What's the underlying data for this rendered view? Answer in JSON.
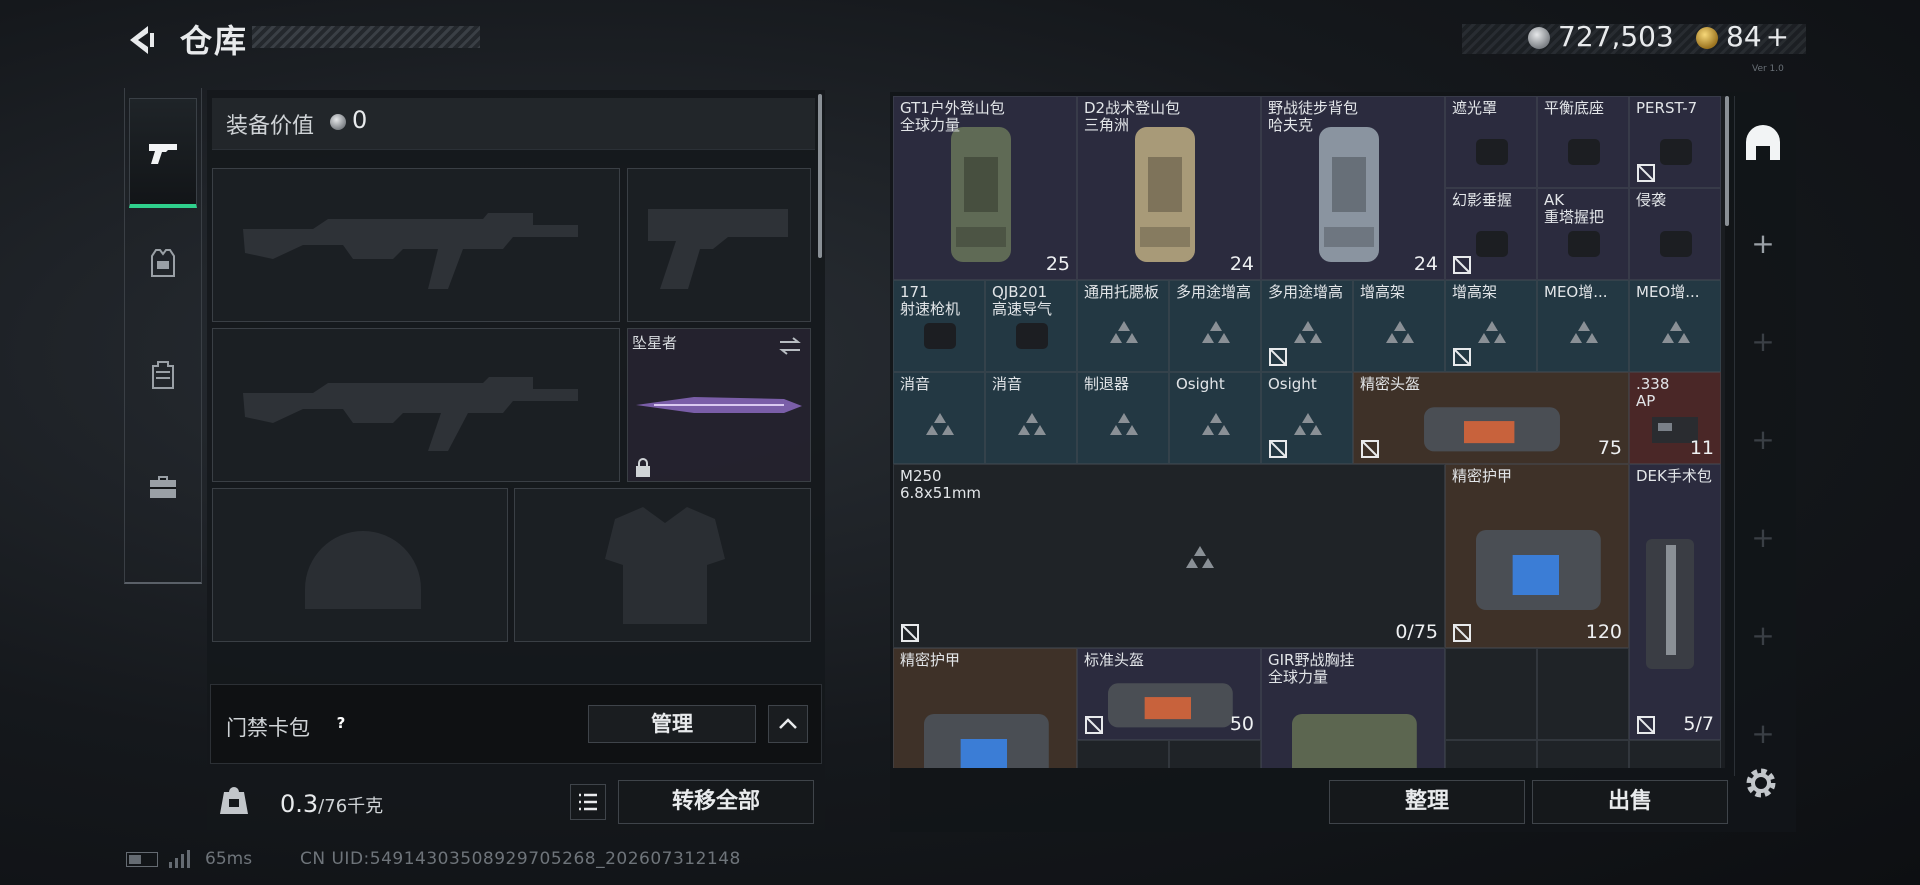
{
  "header": {
    "title": "仓库",
    "silver_amount": "727,503",
    "gold_amount": "84",
    "gold_plus": "+",
    "tiny_text": "Ver 1.0"
  },
  "rail": {
    "tabs": [
      "weapons",
      "armor",
      "backpack",
      "case"
    ]
  },
  "equipment": {
    "label": "装备价值",
    "value": "0",
    "melee_name": "坠星者"
  },
  "keycard": {
    "label": "门禁卡包",
    "help": "?",
    "manage": "管理"
  },
  "weight": {
    "current": "0.3",
    "max": "/76千克"
  },
  "transfer_all": "转移全部",
  "status": {
    "ping": "65ms",
    "uid": "CN UID:5491430350892970​5268_202607312148"
  },
  "inventory": {
    "items": [
      {
        "id": "gt1",
        "name": "GT1户外登山包\n全球力量",
        "count": "25",
        "color": "purple"
      },
      {
        "id": "d2",
        "name": "D2战术登山包\n三角洲",
        "count": "24",
        "color": "purple"
      },
      {
        "id": "field-pack",
        "name": "野战徒步背包\n哈夫克",
        "count": "24",
        "color": "purple"
      },
      {
        "id": "hood",
        "name": "遮光罩",
        "color": "purple"
      },
      {
        "id": "balance",
        "name": "平衡底座",
        "color": "purple"
      },
      {
        "id": "perst",
        "name": "PERST-7",
        "color": "purple"
      },
      {
        "id": "phantom",
        "name": "幻影垂握",
        "color": "purple"
      },
      {
        "id": "ak-grip",
        "name": "AK\n重塔握把",
        "color": "purple"
      },
      {
        "id": "raid",
        "name": "侵袭",
        "color": "purple"
      },
      {
        "id": "m171",
        "name": "171\n射速枪机",
        "color": "blue"
      },
      {
        "id": "qjb",
        "name": "QJB201\n高速导气",
        "color": "blue"
      },
      {
        "id": "cheek",
        "name": "通用托腮板",
        "color": "blue"
      },
      {
        "id": "riser1",
        "name": "多用途增高",
        "color": "blue"
      },
      {
        "id": "riser2",
        "name": "多用途增高",
        "color": "blue"
      },
      {
        "id": "mount1",
        "name": "增高架",
        "color": "blue"
      },
      {
        "id": "mount2",
        "name": "增高架",
        "color": "blue"
      },
      {
        "id": "meo1",
        "name": "MEO增...",
        "color": "blue"
      },
      {
        "id": "meo2",
        "name": "MEO增...",
        "color": "blue"
      },
      {
        "id": "sup1",
        "name": "消音",
        "color": "blue"
      },
      {
        "id": "sup2",
        "name": "消音",
        "color": "blue"
      },
      {
        "id": "brake",
        "name": "制退器",
        "color": "blue"
      },
      {
        "id": "osight1",
        "name": "Osight",
        "color": "blue"
      },
      {
        "id": "osight2",
        "name": "Osight",
        "color": "blue"
      },
      {
        "id": "helmet-p",
        "name": "精密头盔",
        "count": "75",
        "color": "brown"
      },
      {
        "id": "ap338",
        "name": ".338\nAP",
        "count": "11",
        "color": "red"
      },
      {
        "id": "m250",
        "name": "M250\n6.8x51mm",
        "count": "0/75",
        "color": "empty"
      },
      {
        "id": "armor-p",
        "name": "精密护甲",
        "count": "120",
        "color": "brown"
      },
      {
        "id": "dek",
        "name": "DEK手术包",
        "count": "5/7",
        "color": "purple"
      },
      {
        "id": "armor-p2",
        "name": "精密护甲",
        "color": "brown"
      },
      {
        "id": "helmet-s",
        "name": "标准头盔",
        "count": "50",
        "color": "purple"
      },
      {
        "id": "gir",
        "name": "GIR野战胸挂\n全球力量",
        "color": "purple"
      }
    ]
  },
  "actions": {
    "sort": "整理",
    "sell": "出售"
  },
  "colors": {
    "accent": "#2fd08c",
    "purple": "#2b2b3e",
    "blue": "#233843",
    "brown": "#3e3128",
    "red": "#4a2727"
  }
}
